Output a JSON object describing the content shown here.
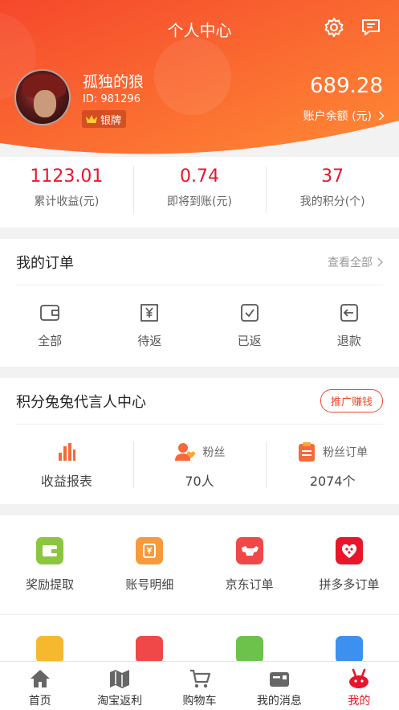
{
  "header": {
    "title": "个人中心",
    "settings_icon": "gear-icon",
    "message_icon": "chat-icon"
  },
  "user": {
    "name": "孤独的狼",
    "id_text": "ID: 981296",
    "badge": "银牌",
    "balance": "689.28",
    "balance_label": "账户余额 (元)"
  },
  "stats": [
    {
      "value": "1123.01",
      "label": "累计收益(元)"
    },
    {
      "value": "0.74",
      "label": "即将到账(元)"
    },
    {
      "value": "37",
      "label": "我的积分(个)"
    }
  ],
  "orders": {
    "title": "我的订单",
    "view_all": "查看全部",
    "items": [
      {
        "label": "全部",
        "icon": "wallet-icon"
      },
      {
        "label": "待返",
        "icon": "yen-icon"
      },
      {
        "label": "已返",
        "icon": "check-box-icon"
      },
      {
        "label": "退款",
        "icon": "refund-icon"
      }
    ]
  },
  "spokesperson": {
    "title": "积分兔兔代言人中心",
    "promo_button": "推广赚钱",
    "report_label": "收益报表",
    "fans_label": "粉丝",
    "fans_value": "70人",
    "fan_orders_label": "粉丝订单",
    "fan_orders_value": "2074个"
  },
  "services": [
    {
      "label": "奖励提取",
      "icon": "wallet-green-icon",
      "color": "#8cc63f"
    },
    {
      "label": "账号明细",
      "icon": "ledger-icon",
      "color": "#f79a3c"
    },
    {
      "label": "京东订单",
      "icon": "jd-dog-icon",
      "color": "#f04848"
    },
    {
      "label": "拼多多订单",
      "icon": "pdd-icon",
      "color": "#e8162b"
    }
  ],
  "services_row2": [
    {
      "icon": "shield-check-icon",
      "color": "#f5b82e"
    },
    {
      "icon": "invoice-icon",
      "color": "#f04848"
    },
    {
      "icon": "leaf-icon",
      "color": "#6cc24a"
    },
    {
      "icon": "gear-blue-icon",
      "color": "#3d8ff0"
    }
  ],
  "tabbar": [
    {
      "label": "首页",
      "icon": "home-icon",
      "active": false
    },
    {
      "label": "淘宝返利",
      "icon": "map-icon",
      "active": false
    },
    {
      "label": "购物车",
      "icon": "cart-icon",
      "active": false
    },
    {
      "label": "我的消息",
      "icon": "mailbox-icon",
      "active": false
    },
    {
      "label": "我的",
      "icon": "rabbit-icon",
      "active": true
    }
  ],
  "colors": {
    "brand_red": "#e8162b",
    "header_orange": "#ff7a2e",
    "header_red": "#f2402a"
  }
}
